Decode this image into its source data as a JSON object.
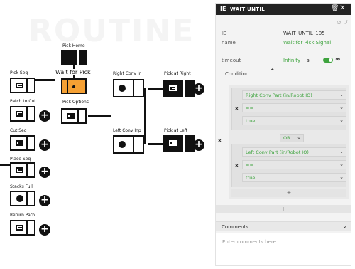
{
  "canvas": {
    "background_text": "ROUTINE",
    "blocks": {
      "pick_home": "Pick Home",
      "wait_for_pick": "Wait for Pick",
      "pick_options": "Pick Options",
      "pick_seq": "Pick Seq",
      "patch_to_cut": "Patch to Cut",
      "cut_seq": "Cut Seq",
      "place_seq": "Place Seq",
      "stacks_full": "Stacks Full",
      "return_path": "Return Path",
      "right_conv_in": "Right Conv In",
      "pick_at_right": "Pick at Right",
      "left_conv_inp": "Left Conv Inp",
      "pick_at_left": "Pick at Left"
    }
  },
  "panel": {
    "header": {
      "icon_text": "IE",
      "title": "WAIT UNTIL",
      "trash_icon": "trash-icon",
      "close_icon": "close-icon"
    },
    "toolbar": {
      "disable_icon": "⊘",
      "reset_icon": "↺"
    },
    "id_label": "ID",
    "id_value": "WAIT_UNTIL_105",
    "name_label": "name",
    "name_value": "Wait for Pick Signal",
    "timeout_label": "timeout",
    "timeout_value": "Infinity",
    "timeout_unit": "s",
    "infinity_symbol": "∞",
    "condition_label": "Condition",
    "conditions": [
      {
        "signal": "Right Conv Part (in/Robot IO)",
        "operator": "==",
        "value": "true"
      },
      {
        "signal": "Left Conv Part (in/Robot IO)",
        "operator": "==",
        "value": "true"
      }
    ],
    "logic_op": "OR",
    "add_label": "+",
    "comments_label": "Comments",
    "comments_placeholder": "Enter comments here.",
    "accent_color": "#3da33d"
  }
}
